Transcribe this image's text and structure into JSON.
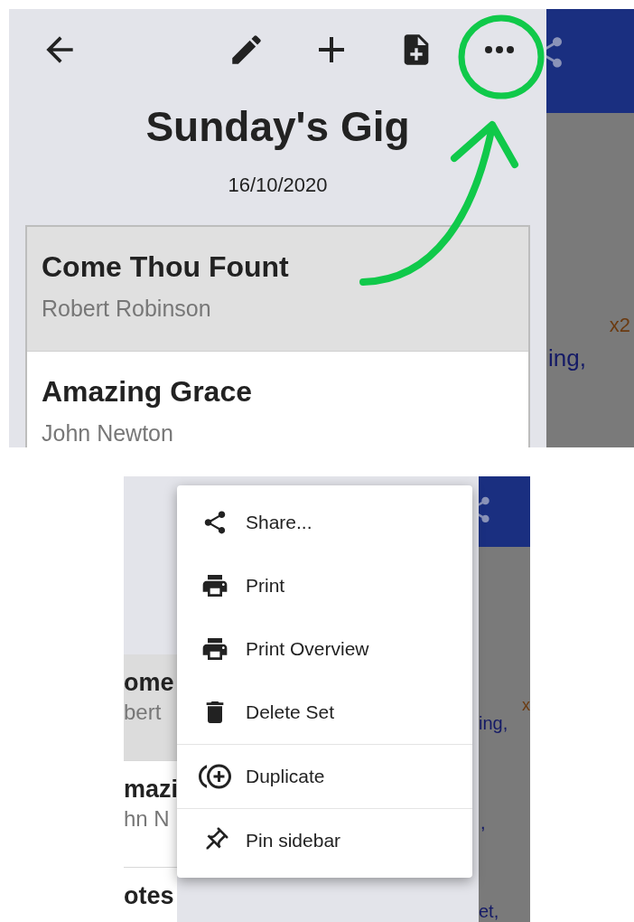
{
  "screen_1": {
    "set_title": "Sunday's Gig",
    "set_date": "16/10/2020",
    "songs": [
      {
        "title": "Come Thou Fount",
        "author": "Robert Robinson",
        "selected": true
      },
      {
        "title": "Amazing Grace",
        "author": "John Newton",
        "selected": false
      }
    ],
    "background_text": [
      "x2",
      "ing,"
    ]
  },
  "screen_2": {
    "list_fragments": [
      {
        "title": "ome",
        "author": "bert",
        "selected": true
      },
      {
        "title": "mazi",
        "author": "hn N",
        "selected": false
      },
      {
        "title": "otes",
        "selected": false
      }
    ],
    "menu": [
      {
        "label": "Share...",
        "kind": "share",
        "divider_before": false
      },
      {
        "label": "Print",
        "kind": "print",
        "divider_before": false
      },
      {
        "label": "Print Overview",
        "kind": "print",
        "divider_before": false
      },
      {
        "label": "Delete Set",
        "kind": "delete",
        "divider_before": false
      },
      {
        "label": "Duplicate",
        "kind": "duplicate",
        "divider_before": true
      },
      {
        "label": "Pin sidebar",
        "kind": "pin",
        "divider_before": true
      }
    ],
    "background_text": [
      "x",
      "ing,",
      ",",
      "et,"
    ]
  }
}
